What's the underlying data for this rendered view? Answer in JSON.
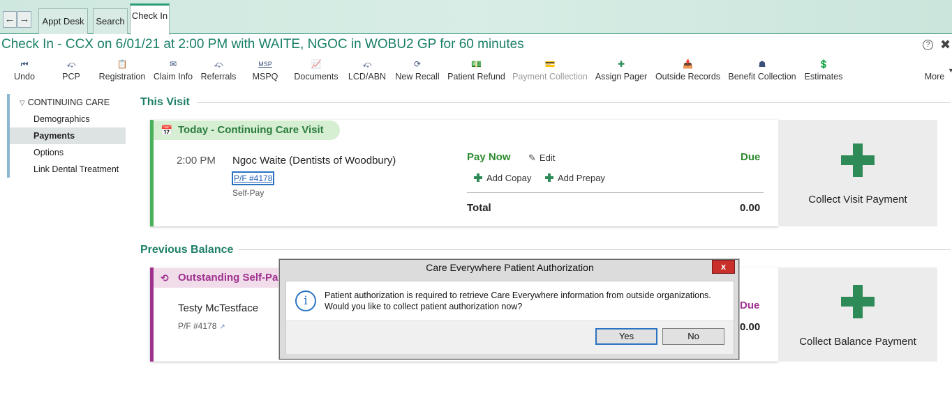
{
  "tabs": {
    "appt_desk": "Appt Desk",
    "search": "Search",
    "check_in": "Check In"
  },
  "title": "Check In - CCX on 6/01/21 at 2:00 PM with WAITE, NGOC in WOBU2 GP for 60 minutes",
  "help": "?",
  "toolbar": {
    "undo": "Undo",
    "pcp": "PCP",
    "registration": "Registration",
    "claim_info": "Claim Info",
    "referrals": "Referrals",
    "mspq": "MSPQ",
    "mspq_icon_text": "MSP",
    "documents": "Documents",
    "lcd_abn": "LCD/ABN",
    "new_recall": "New Recall",
    "patient_refund": "Patient Refund",
    "payment_collection": "Payment Collection",
    "assign_pager": "Assign Pager",
    "outside_records": "Outside Records",
    "benefit_collection": "Benefit Collection",
    "estimates": "Estimates",
    "more": "More"
  },
  "leftnav": {
    "header": "CONTINUING CARE",
    "items": [
      "Demographics",
      "Payments",
      "Options",
      "Link Dental Treatment"
    ],
    "selected": "Payments"
  },
  "this_visit": {
    "section_title": "This Visit",
    "pill": "Today - Continuing Care Visit",
    "time": "2:00 PM",
    "provider": "Ngoc Waite (Dentists of Woodbury)",
    "pf_link": "P/F #4178",
    "payer": "Self-Pay",
    "pay_now": "Pay Now",
    "edit": "Edit",
    "due": "Due",
    "add_copay": "Add Copay",
    "add_prepay": "Add Prepay",
    "total_label": "Total",
    "total_value": "0.00",
    "collect_label": "Collect Visit Payment"
  },
  "previous_balance": {
    "section_title": "Previous Balance",
    "pill": "Outstanding Self-Pa",
    "patient": "Testy McTestface",
    "pf": "P/F #4178",
    "due": "Due",
    "amount": "0.00",
    "collect_label": "Collect Balance Payment"
  },
  "dialog": {
    "title": "Care Everywhere Patient Authorization",
    "close": "x",
    "line1": "Patient authorization is required to retrieve Care Everywhere information from outside organizations.",
    "line2": "Would you like to collect patient authorization now?",
    "yes": "Yes",
    "no": "No"
  },
  "colors": {
    "accent": "#167e66",
    "green_bar": "#4ab05a",
    "purple_bar": "#a0328f",
    "plus": "#2e8b57",
    "dialog_close": "#c9302c"
  }
}
